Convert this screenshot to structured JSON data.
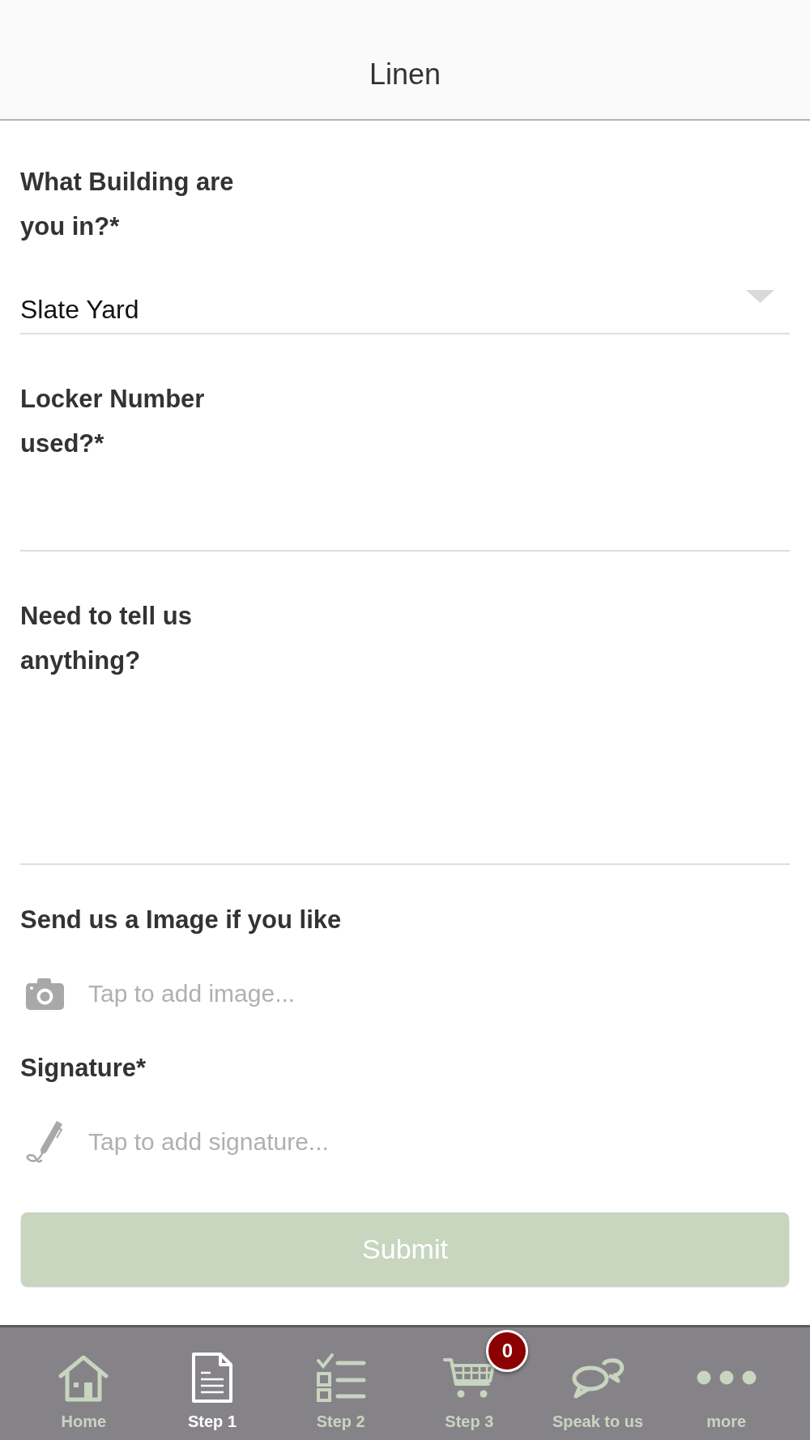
{
  "header": {
    "title": "Linen"
  },
  "fields": [
    {
      "kind": "select",
      "label": "What Building are you in?*",
      "value": "Slate Yard"
    },
    {
      "kind": "text",
      "label": "Locker Number used?*"
    },
    {
      "kind": "textarea",
      "label": "Need to tell us anything?"
    },
    {
      "kind": "image",
      "label": "Send us a Image if you like",
      "placeholder": "Tap to add image..."
    },
    {
      "kind": "signature",
      "label": "Signature*",
      "placeholder": "Tap to add signature..."
    }
  ],
  "submit": {
    "label": "Submit"
  },
  "tab_bar": {
    "tabs": [
      {
        "label": "Home",
        "selected": false
      },
      {
        "label": "Step 1",
        "selected": true
      },
      {
        "label": "Step 2",
        "selected": false
      },
      {
        "label": "Step 3",
        "selected": false,
        "badge": "0"
      },
      {
        "label": "Speak to us",
        "selected": false
      },
      {
        "label": "more",
        "selected": false
      }
    ]
  }
}
